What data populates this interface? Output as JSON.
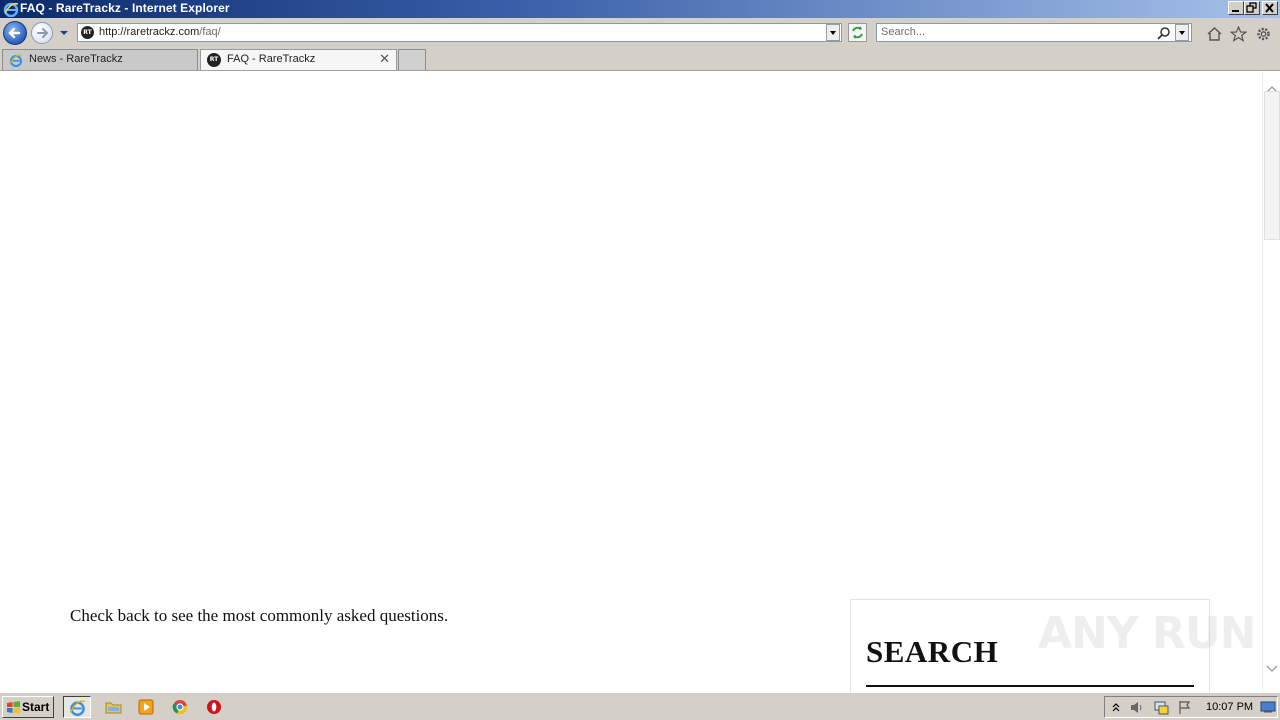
{
  "window": {
    "title": "FAQ - RareTrackz - Internet Explorer"
  },
  "address_bar": {
    "url_host": "http://raretrackz.com",
    "url_path": "/faq/",
    "favicon_text": "RT"
  },
  "search_bar": {
    "placeholder": "Search..."
  },
  "tabs": [
    {
      "label": "News - RareTrackz",
      "active": false
    },
    {
      "label": "FAQ - RareTrackz",
      "active": true
    }
  ],
  "page": {
    "body_text": "Check back to see the most commonly asked questions.",
    "sidebar_search_heading": "SEARCH"
  },
  "watermark": "ANY RUN",
  "taskbar": {
    "start_label": "Start",
    "clock": "10:07 PM"
  }
}
